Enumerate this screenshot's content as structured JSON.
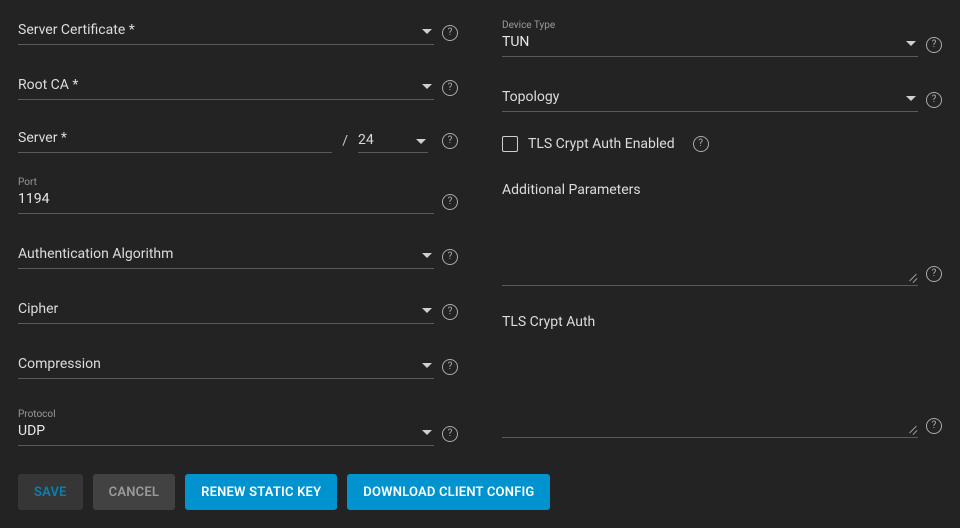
{
  "left": {
    "server_cert_label": "Server Certificate *",
    "root_ca_label": "Root CA *",
    "server_label": "Server *",
    "server_cidr": "24",
    "port_small_label": "Port",
    "port_value": "1194",
    "auth_algo_label": "Authentication Algorithm",
    "cipher_label": "Cipher",
    "compression_label": "Compression",
    "protocol_small_label": "Protocol",
    "protocol_value": "UDP"
  },
  "right": {
    "device_type_small_label": "Device Type",
    "device_type_value": "TUN",
    "topology_label": "Topology",
    "tls_checkbox_label": "TLS Crypt Auth Enabled",
    "additional_params_label": "Additional Parameters",
    "tls_crypt_auth_label": "TLS Crypt Auth"
  },
  "buttons": {
    "save": "SAVE",
    "cancel": "CANCEL",
    "renew": "RENEW STATIC KEY",
    "download": "DOWNLOAD CLIENT CONFIG"
  }
}
